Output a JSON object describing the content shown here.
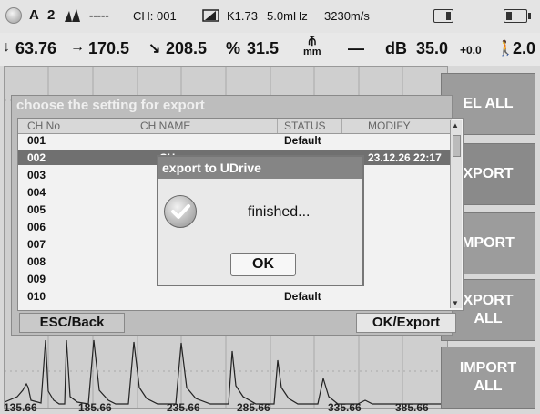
{
  "status_bar": {
    "gate_a": "A",
    "channel_index": "2",
    "dashes": "-----",
    "ch_label": "CH: 001",
    "k_value": "K1.73",
    "frequency": "5.0mHz",
    "velocity": "3230m/s",
    "icons": [
      "status-dot-icon",
      "wave-peaks-icon",
      "probe-icon",
      "freeze-icon",
      "battery-icon"
    ]
  },
  "measure_bar": {
    "depth": "63.76",
    "path": "170.5",
    "surface": "208.5",
    "percent_label": "%",
    "amplitude": "31.5",
    "mm_unit_top": "⫚",
    "mm_unit_bottom": "mm",
    "dash": "—",
    "db_label": "dB",
    "gain": "35.0",
    "gain_offset": "+0.0",
    "step": "2.0",
    "icons": [
      "arrow-down-icon",
      "arrow-right-icon",
      "arrow-diagonal-icon",
      "mm-icon",
      "walking-person-icon"
    ]
  },
  "waveform": {
    "x_ticks": [
      "135.66",
      "185.66",
      "235.66",
      "285.66",
      "335.66",
      "385.66"
    ]
  },
  "side_buttons": {
    "sel_all": "EL ALL",
    "export": "XPORT",
    "import": "MPORT",
    "export_all": "XPORT\nALL",
    "import_all": "IMPORT\nALL"
  },
  "export_panel": {
    "title": "choose the setting for export",
    "columns": [
      "CH No",
      "CH NAME",
      "STATUS",
      "MODIFY"
    ],
    "rows": [
      {
        "no": "001",
        "name": "",
        "status": "Default",
        "modify": ""
      },
      {
        "no": "002",
        "name": "CH",
        "status": "",
        "modify": "23.12.26  22:17"
      },
      {
        "no": "003",
        "name": "",
        "status": "",
        "modify": ""
      },
      {
        "no": "004",
        "name": "",
        "status": "",
        "modify": ""
      },
      {
        "no": "005",
        "name": "",
        "status": "",
        "modify": ""
      },
      {
        "no": "006",
        "name": "",
        "status": "",
        "modify": ""
      },
      {
        "no": "007",
        "name": "",
        "status": "",
        "modify": ""
      },
      {
        "no": "008",
        "name": "",
        "status": "",
        "modify": ""
      },
      {
        "no": "009",
        "name": "",
        "status": "",
        "modify": ""
      },
      {
        "no": "010",
        "name": "",
        "status": "Default",
        "modify": ""
      }
    ],
    "selected_row": 1,
    "esc_button": "ESC/Back",
    "ok_button": "OK/Export"
  },
  "dialog": {
    "title": "export to UDrive",
    "message": "finished...",
    "ok": "OK"
  },
  "colors": {
    "panel_bg": "#bdbdbd",
    "selected_row": "#707070",
    "side_button": "#9c9c9c"
  }
}
